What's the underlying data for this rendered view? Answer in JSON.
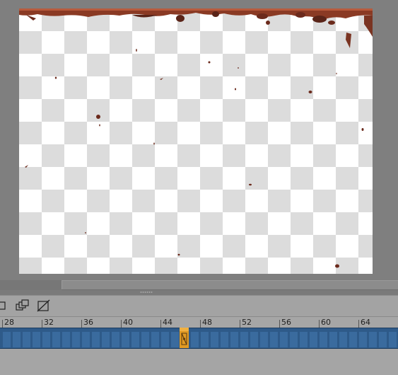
{
  "timeline": {
    "ruler_labels": [
      "28",
      "32",
      "36",
      "40",
      "44",
      "48",
      "52",
      "56",
      "60",
      "64"
    ],
    "current_frame": 46
  },
  "toolbar": {
    "icons": [
      "onion-skin-icon",
      "multi-frame-icon",
      "no-onion-icon"
    ]
  },
  "colors": {
    "canvas_bg": "#7f7f7f",
    "checker_light": "#ffffff",
    "checker_dark": "#dcdcdc",
    "frame_track": "#2e5a89",
    "playhead": "#e8a020",
    "paint": "#7a3422"
  }
}
